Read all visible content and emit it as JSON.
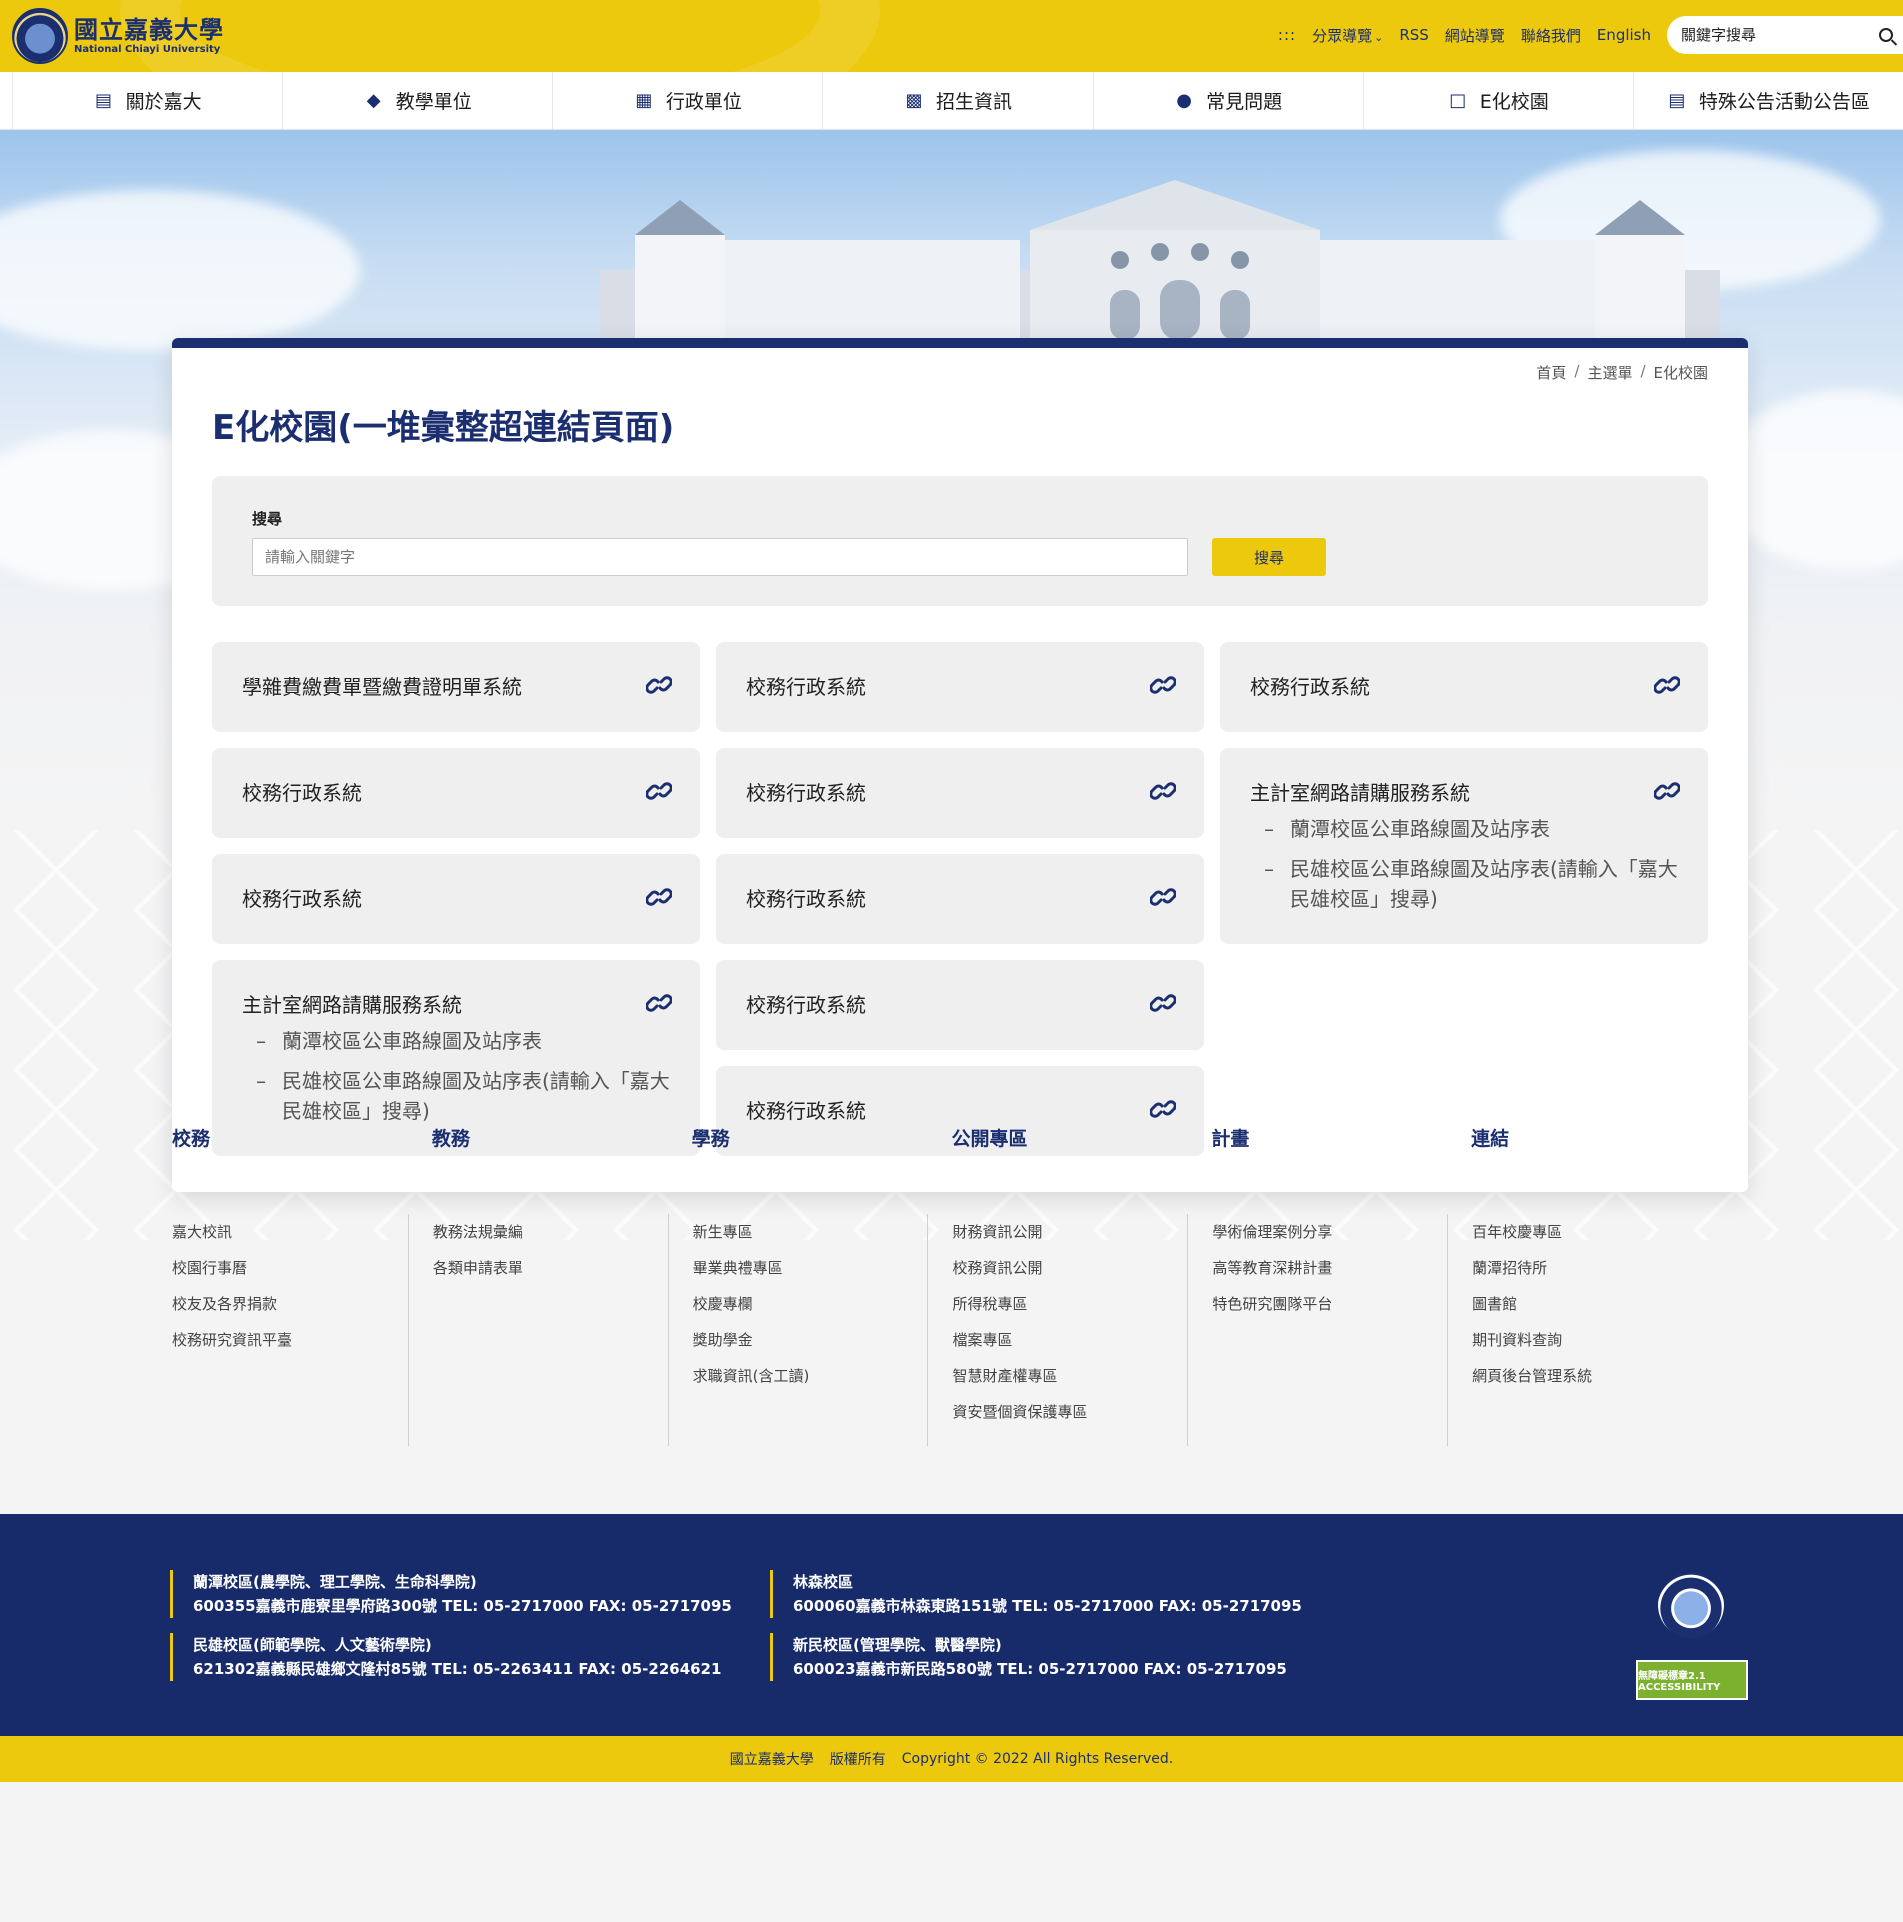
{
  "header": {
    "logo_zh": "國立嘉義大學",
    "logo_en": "National Chiayi University",
    "links": {
      "sitemap_dots": ":::",
      "audience": "分眾導覽",
      "rss": "RSS",
      "site_guide": "網站導覽",
      "contact": "聯絡我們",
      "english": "English"
    },
    "search_placeholder": "關鍵字搜尋"
  },
  "nav": [
    {
      "label": "關於嘉大",
      "icon": "building-icon"
    },
    {
      "label": "教學單位",
      "icon": "graduation-cap-icon"
    },
    {
      "label": "行政單位",
      "icon": "id-card-icon"
    },
    {
      "label": "招生資訊",
      "icon": "user-board-icon"
    },
    {
      "label": "常見問題",
      "icon": "question-chat-icon"
    },
    {
      "label": "E化校園",
      "icon": "computer-icon"
    },
    {
      "label": "特殊公告活動公告區",
      "icon": "calendar-list-icon"
    }
  ],
  "breadcrumb": [
    "首頁",
    "/",
    "主選單",
    "/",
    "E化校園"
  ],
  "page_title": "E化校園(一堆彙整超連結頁面)",
  "search": {
    "label": "搜尋",
    "placeholder": "請輸入關鍵字",
    "button": "搜尋"
  },
  "link_cards": [
    {
      "title": "學雜費繳費單暨繳費證明單系統"
    },
    {
      "title": "校務行政系統"
    },
    {
      "title": "校務行政系統"
    },
    {
      "title": "校務行政系統"
    },
    {
      "title": "校務行政系統"
    },
    {
      "title": "主計室網路請購服務系統",
      "subs": [
        "蘭潭校區公車路線圖及站序表",
        "民雄校區公車路線圖及站序表(請輸入「嘉大民雄校區」搜尋)"
      ]
    },
    {
      "title": "校務行政系統"
    },
    {
      "title": "校務行政系統"
    },
    {
      "title": "主計室網路請購服務系統",
      "subs": [
        "蘭潭校區公車路線圖及站序表",
        "民雄校區公車路線圖及站序表(請輸入「嘉大民雄校區」搜尋)"
      ]
    },
    {
      "title": "校務行政系統"
    },
    {
      "title": "校務行政系統"
    }
  ],
  "footer_columns": [
    {
      "heading": "校務",
      "items": [
        "嘉大校訊",
        "校園行事曆",
        "校友及各界捐款",
        "校務研究資訊平臺"
      ]
    },
    {
      "heading": "教務",
      "items": [
        "教務法規彙編",
        "各類申請表單"
      ]
    },
    {
      "heading": "學務",
      "items": [
        "新生專區",
        "畢業典禮專區",
        "校慶專欄",
        "獎助學金",
        "求職資訊(含工讀)"
      ]
    },
    {
      "heading": "公開專區",
      "items": [
        "財務資訊公開",
        "校務資訊公開",
        "所得稅專區",
        "檔案專區",
        "智慧財產權專區",
        "資安暨個資保護專區"
      ]
    },
    {
      "heading": "計畫",
      "items": [
        "學術倫理案例分享",
        "高等教育深耕計畫",
        "特色研究團隊平台"
      ]
    },
    {
      "heading": "連結",
      "items": [
        "百年校慶專區",
        "蘭潭招待所",
        "圖書館",
        "期刊資料查詢",
        "網頁後台管理系統"
      ]
    }
  ],
  "campuses": [
    {
      "name": "蘭潭校區(農學院、理工學院、生命科學院)",
      "address": "600355嘉義市鹿寮里學府路300號 TEL: 05-2717000 FAX: 05-2717095"
    },
    {
      "name": "林森校區",
      "address": "600060嘉義市林森東路151號 TEL: 05-2717000 FAX: 05-2717095"
    },
    {
      "name": "民雄校區(師範學院、人文藝術學院)",
      "address": "621302嘉義縣民雄鄉文隆村85號 TEL: 05-2263411 FAX: 05-2264621"
    },
    {
      "name": "新民校區(管理學院、獸醫學院)",
      "address": "600023嘉義市新民路580號 TEL: 05-2717000 FAX: 05-2717095"
    }
  ],
  "a11y_badge": "無障礙標章2.1 ACCESSIBILITY",
  "copyright": {
    "org": "國立嘉義大學",
    "rights": "版權所有",
    "text": "Copyright © 2022 All Rights Reserved."
  },
  "colors": {
    "brand_yellow": "#ecc90c",
    "brand_navy": "#1b2e70",
    "card_grey": "#efefef"
  }
}
